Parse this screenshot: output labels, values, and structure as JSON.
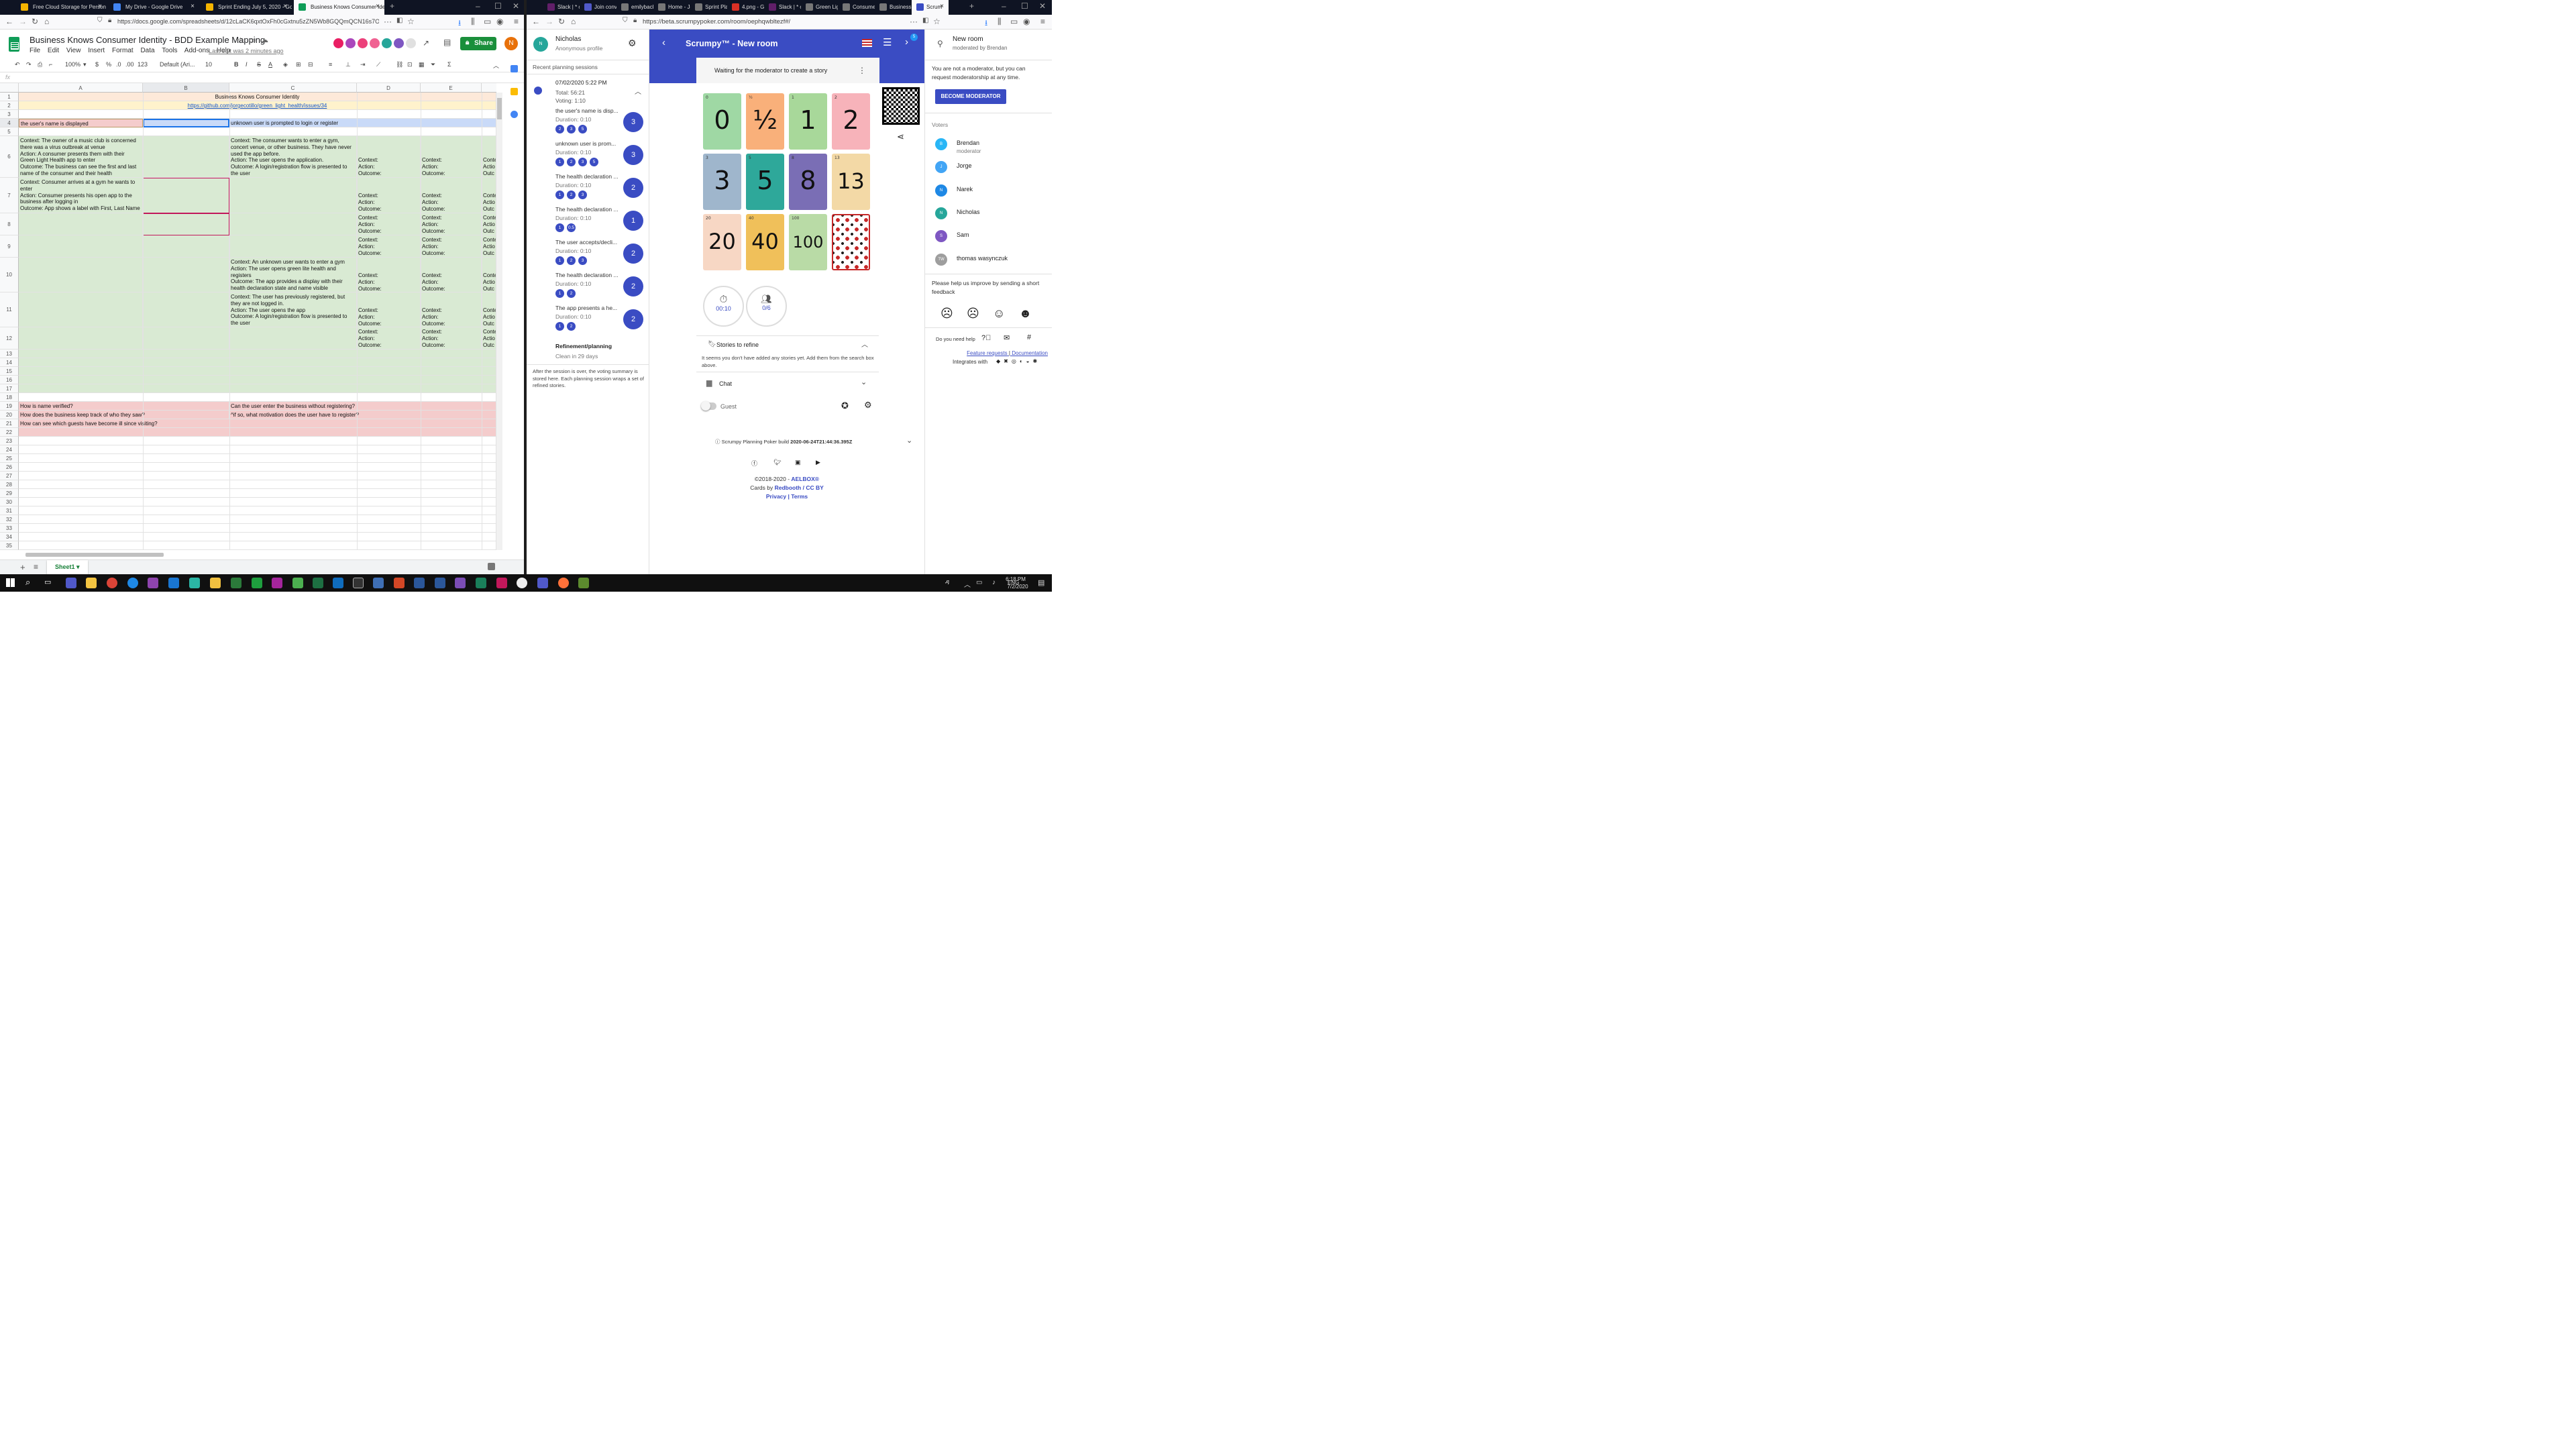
{
  "left_browser": {
    "tabs": [
      {
        "label": "Free Cloud Storage for Person",
        "color": "#f4b400"
      },
      {
        "label": "My Drive - Google Drive",
        "color": "#4285f4"
      },
      {
        "label": "Sprint Ending July 5, 2020 - Go",
        "color": "#f4b400"
      },
      {
        "label": "Business Knows Consumer Ide",
        "color": "#0f9d58"
      }
    ],
    "url": "https://docs.google.com/spreadsheets/d/12cLaCK6qxtOxFh0cGxtnu5zZN5Wb8GQQmQCN16s7OiY/edit#"
  },
  "sheets": {
    "title": "Business Knows Consumer Identity - BDD Example Mapping",
    "menu": [
      "File",
      "Edit",
      "View",
      "Insert",
      "Format",
      "Data",
      "Tools",
      "Add-ons",
      "Help"
    ],
    "last_edit": "Last edit was 2 minutes ago",
    "share_label": "Share",
    "user_initial": "N",
    "toolbar": {
      "zoom": "100%",
      "currency": "$",
      "percent": "%",
      "dec0": ".0",
      "dec2": ".00",
      "format": "123",
      "font": "Default (Ari...",
      "size": "10",
      "bold": "B",
      "italic": "I",
      "strike": "S",
      "color_a": "A"
    },
    "fx": "fx",
    "columns": [
      "A",
      "B",
      "C",
      "D",
      "E"
    ],
    "row_numbers": [
      "1",
      "2",
      "3",
      "4",
      "5",
      "6",
      "7",
      "8",
      "9",
      "10",
      "11",
      "12",
      "13",
      "14",
      "15",
      "16",
      "17",
      "18",
      "19",
      "20",
      "21",
      "22",
      "23",
      "24",
      "25",
      "26",
      "27",
      "28",
      "29",
      "30",
      "31",
      "32",
      "33",
      "34",
      "35"
    ],
    "cells": {
      "r1_title": "Business Knows Consumer Identity",
      "r2_link": "https://github.com/jorgecotillo/green_light_health/issues/34",
      "r4_a": "the user's name is displayed",
      "r4_c": "unknown user is prompted to login or register",
      "r6_a": "Context: The owner of a music club is concerned there was a virus outbreak at venue\nAction: A consumer presents them with their Green Light Health app to enter\nOutcome: The business can see the first and last name of the consumer and their health declaration.",
      "r6_c": "Context: The consumer wants to enter a gym, concert venue, or other business. They have never used the app before.\nAction: The user opens the application.\nOutcome: A login/registration flow is presented to the user",
      "r6_d": "Context:\nAction:\nOutcome:",
      "r6_e": "Context:\nAction:\nOutcome:",
      "r6_f": "Conte\nActio\nOutc",
      "r7_a": "Context: Consumer arrives at a gym he wants to enter\nAction: Consumer presents his open app to the business after logging in\nOutcome: App shows a label with First, Last Name",
      "r10_c": "Context: An unknown user wants to enter a gym\nAction: The user opens green lite health and registers\nOutcome: The app provides a display with their health declaration state and name visible",
      "r11_c": "Context: The user has previously registered, but they are not logged in.\nAction: The user opens the app\nOutcome: A login/registration flow is presented to the user",
      "r19_a": "How is name verified?",
      "r19_c": "Can the user enter the business without registering?",
      "r20_a": "How does the business keep track of who they saw?",
      "r20_c": "^if so, what motivation does the user have to register?",
      "r21_a": "How can see which guests have become ill since visiting?"
    },
    "sheet_tab": "Sheet1"
  },
  "right_browser": {
    "tabs": [
      "Slack | * c",
      "Join conv",
      "emilyback",
      "Home - Jo",
      "Sprint Pla",
      "4.png - G",
      "Slack | * c",
      "Green Lig",
      "Consume",
      "Business",
      "Scrum"
    ],
    "url": "https://beta.scrumpypoker.com/room/oephqwbltezf#/"
  },
  "scrumpy": {
    "profile_name": "Nicholas",
    "profile_sub": "Anonymous profile",
    "recent_title": "Recent planning sessions",
    "session_date": "07/02/2020 5:22 PM",
    "session_total": "Total: 56:21",
    "session_voting": "Voting: 1:10",
    "sessions": [
      {
        "title": "the user's name is disp...",
        "duration": "Duration: 0:10",
        "votes": [
          "2",
          "3",
          "5"
        ],
        "result": "3"
      },
      {
        "title": "unknown user is prom...",
        "duration": "Duration: 0:10",
        "votes": [
          "1",
          "2",
          "3",
          "5"
        ],
        "result": "3"
      },
      {
        "title": "The health declaration ...",
        "duration": "Duration: 0:10",
        "votes": [
          "1",
          "2",
          "3"
        ],
        "result": "2"
      },
      {
        "title": "The health declaration ...",
        "duration": "Duration: 0:10",
        "votes": [
          "1",
          "0.5"
        ],
        "result": "1"
      },
      {
        "title": "The user accepts/decli...",
        "duration": "Duration: 0:10",
        "votes": [
          "1",
          "2",
          "3"
        ],
        "result": "2"
      },
      {
        "title": "The health declaration ...",
        "duration": "Duration: 0:10",
        "votes": [
          "1",
          "2"
        ],
        "result": "2"
      },
      {
        "title": "The app presents a he...",
        "duration": "Duration: 0:10",
        "votes": [
          "1",
          "2"
        ],
        "result": "2"
      }
    ],
    "refinement_title": "Refinement/planning",
    "refinement_sub": "Clean in 29 days",
    "side_note": "After the session is over, the voting summary is stored here. Each planning session wraps a set of refined stories.",
    "room_title": "Scrumpy™ - New room",
    "badge": "5",
    "waiting": "Waiting for the moderator to create a story",
    "cards": [
      {
        "big": "0",
        "corner": "0",
        "bg": "#9fd8a4"
      },
      {
        "big": "½",
        "corner": "½",
        "bg": "#f9b07a"
      },
      {
        "big": "1",
        "corner": "1",
        "bg": "#a8d89a"
      },
      {
        "big": "2",
        "corner": "2",
        "bg": "#f7b3ba"
      },
      {
        "big": "3",
        "corner": "3",
        "bg": "#9fb6cc"
      },
      {
        "big": "5",
        "corner": "5",
        "bg": "#2ea89a"
      },
      {
        "big": "8",
        "corner": "8",
        "bg": "#7a6eb5"
      },
      {
        "big": "13",
        "corner": "13",
        "bg": "#f3d9a6"
      },
      {
        "big": "20",
        "corner": "20",
        "bg": "#f7d7c4"
      },
      {
        "big": "40",
        "corner": "40",
        "bg": "#f0c05a"
      },
      {
        "big": "100",
        "corner": "100",
        "bg": "#b9dba6"
      },
      {
        "big": "",
        "corner": "",
        "bg": "#ffffff"
      }
    ],
    "timer": "00:10",
    "voters_count": "0/6",
    "stories_label": "Stories to refine",
    "stories_empty": "It seems you don't have added any stories yet. Add them from the search box above.",
    "chat_label": "Chat",
    "guest_label": "Guest",
    "build_prefix": "Scrumpy Planning Poker build ",
    "build_id": "2020-06-24T21:44:36.395Z",
    "copyright": "©2018-2020 - ",
    "copyright_link": "AELBOX®",
    "cards_by": "Cards by ",
    "redbooth": "Redbooth",
    "ccby": " / CC BY",
    "privacy": "Privacy",
    "terms": "Terms",
    "room_name": "New room",
    "moderated_by": "moderated by Brendan",
    "not_moderator": "You are not a moderator, but you can request moderatorship at any time.",
    "become_moderator": "BECOME MODERATOR",
    "voters_title": "Voters",
    "voters": [
      {
        "name": "Brendan",
        "sub": "moderator",
        "initial": "B",
        "color": "#29b6f6"
      },
      {
        "name": "Jorge",
        "sub": "",
        "initial": "J",
        "color": "#42a5f5"
      },
      {
        "name": "Narek",
        "sub": "",
        "initial": "N",
        "color": "#1e88e5"
      },
      {
        "name": "Nicholas",
        "sub": "",
        "initial": "N",
        "color": "#26a69a"
      },
      {
        "name": "Sam",
        "sub": "",
        "initial": "S",
        "color": "#7e57c2"
      },
      {
        "name": "thomas wasynczuk",
        "sub": "",
        "initial": "TW",
        "color": "#9e9e9e"
      }
    ],
    "feedback": "Please help us improve by sending a short feedback",
    "need_help": "Do you need help",
    "feature_requests": "Feature requests",
    "documentation": "Documentation",
    "integrates": "Integrates with"
  },
  "taskbar": {
    "time": "6:18 PM",
    "date": "7/2/2020",
    "lang": "ENG"
  }
}
